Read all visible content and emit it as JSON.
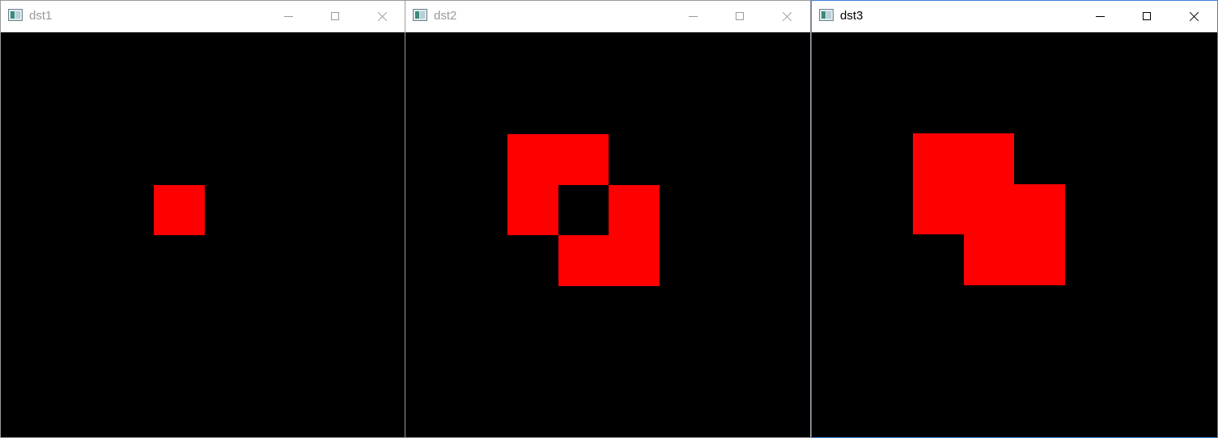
{
  "windows": [
    {
      "title": "dst1"
    },
    {
      "title": "dst2"
    },
    {
      "title": "dst3"
    }
  ],
  "colors": {
    "canvas": "#000000",
    "shape": "#ff0000",
    "inactive_title": "#999999",
    "active_title": "#000000",
    "active_border": "#3c7fd6"
  }
}
